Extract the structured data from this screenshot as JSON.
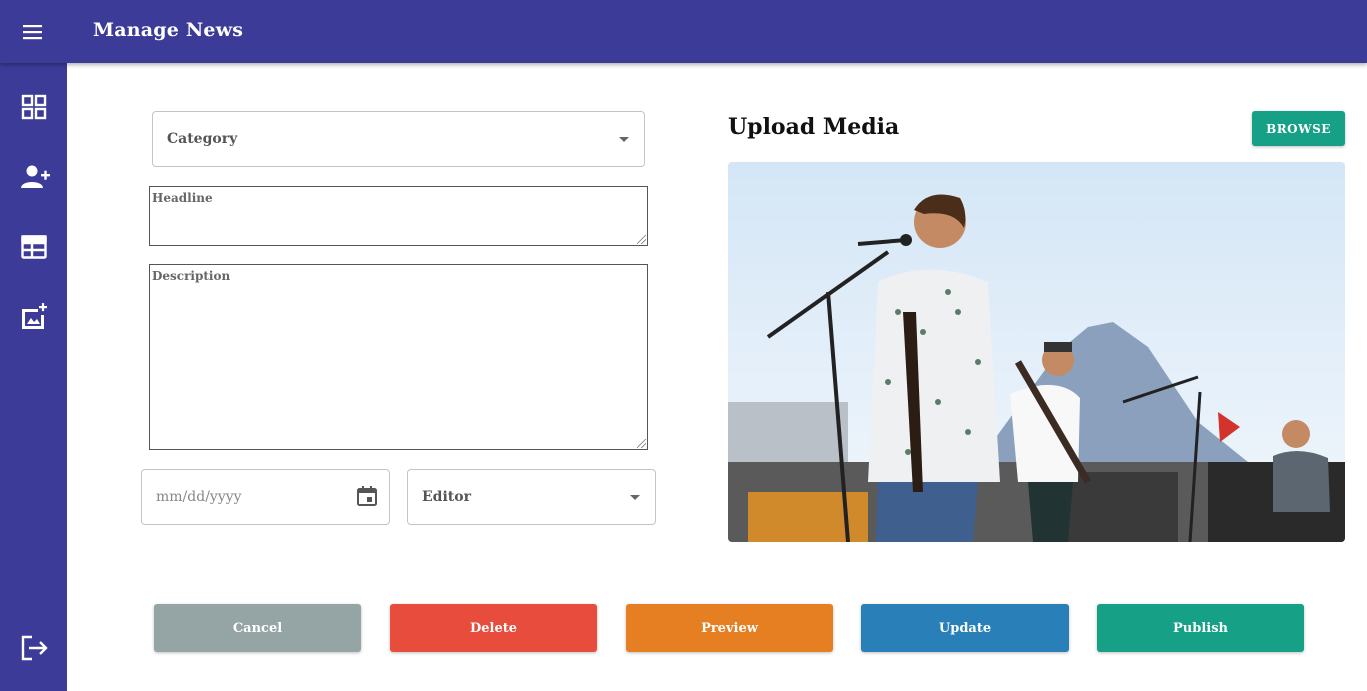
{
  "header": {
    "title": "Manage News"
  },
  "sidebar": {
    "items": [
      {
        "icon": "dashboard-icon"
      },
      {
        "icon": "add-user-icon"
      },
      {
        "icon": "news-layout-icon"
      },
      {
        "icon": "add-image-icon"
      }
    ],
    "logout_icon": "logout-icon"
  },
  "form": {
    "category_placeholder": "Category",
    "headline_placeholder": "Headline",
    "description_placeholder": "Description",
    "date_placeholder": "mm/dd/yyyy",
    "editor_placeholder": "Editor"
  },
  "media": {
    "title": "Upload Media",
    "browse_label": "BROWSE"
  },
  "actions": {
    "cancel": "Cancel",
    "delete": "Delete",
    "preview": "Preview",
    "update": "Update",
    "publish": "Publish"
  },
  "colors": {
    "primary": "#3c3b98",
    "cancel": "#95a5a6",
    "delete": "#e74c3c",
    "preview": "#e67e22",
    "update": "#2980b9",
    "publish": "#16a085"
  }
}
